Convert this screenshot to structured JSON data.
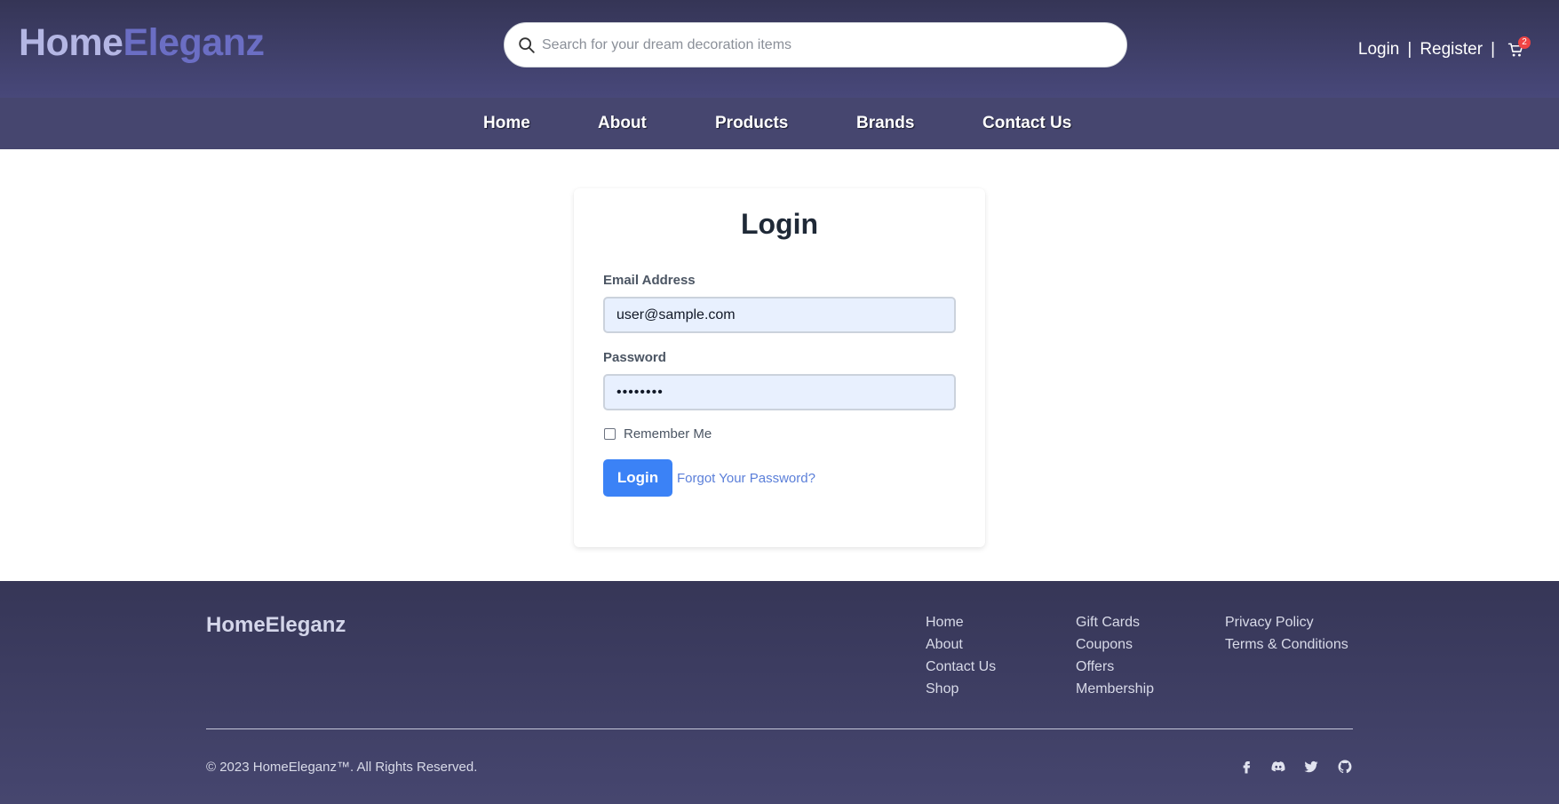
{
  "brand": {
    "part1": "Home",
    "part2": "Eleganz"
  },
  "search": {
    "placeholder": "Search for your dream decoration items"
  },
  "auth": {
    "login": "Login",
    "register": "Register",
    "separator": "|",
    "cart_count": "2"
  },
  "nav": [
    "Home",
    "About",
    "Products",
    "Brands",
    "Contact Us"
  ],
  "login_form": {
    "title": "Login",
    "email_label": "Email Address",
    "email_value": "user@sample.com",
    "password_label": "Password",
    "password_value": "••••••••",
    "remember_label": "Remember Me",
    "submit_label": "Login",
    "forgot_label": "Forgot Your Password?"
  },
  "footer": {
    "brand": "HomeEleganz",
    "columns": [
      [
        "Home",
        "About",
        "Contact Us",
        "Shop"
      ],
      [
        "Gift Cards",
        "Coupons",
        "Offers",
        "Membership"
      ],
      [
        "Privacy Policy",
        "Terms & Conditions"
      ]
    ],
    "copyright": "© 2023 HomeEleganz™. All Rights Reserved.",
    "social_icons": [
      "facebook-icon",
      "discord-icon",
      "twitter-icon",
      "github-icon"
    ]
  },
  "colors": {
    "header_bg": "#353556",
    "nav_bg": "#46466f",
    "brand_light": "#b4b6e4",
    "brand_accent": "#6b6ec4",
    "primary_button": "#3b82f6",
    "badge": "#ef4444",
    "input_bg": "#e8f0fe"
  }
}
